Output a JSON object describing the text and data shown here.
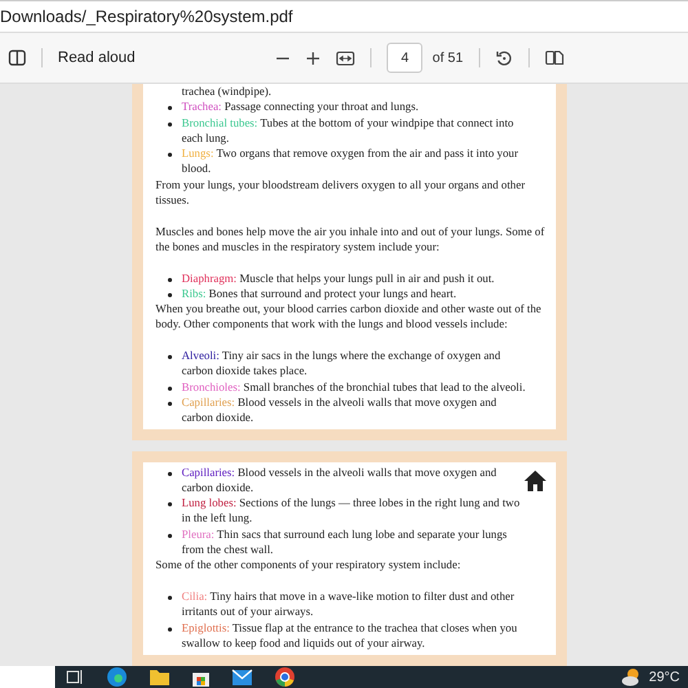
{
  "address_bar": {
    "url": "Downloads/_Respiratory%20system.pdf"
  },
  "toolbar": {
    "read_aloud": "Read aloud",
    "page_number": "4",
    "page_count": "of 51"
  },
  "pages": [
    {
      "blocks": [
        {
          "kind": "cont",
          "text": "trachea (windpipe)."
        },
        {
          "kind": "bullet",
          "term": "Trachea:",
          "color": "#d050c0",
          "text": " Passage connecting your throat and lungs."
        },
        {
          "kind": "bullet",
          "term": "Bronchial tubes:",
          "color": "#3cc890",
          "text": " Tubes at the bottom of your windpipe that connect into each lung."
        },
        {
          "kind": "bullet",
          "term": "Lungs:",
          "color": "#f0b040",
          "text": " Two organs that remove oxygen from the air and pass it into your blood."
        },
        {
          "kind": "para",
          "text": "From your lungs, your bloodstream delivers oxygen to all your organs and other tissues."
        },
        {
          "kind": "para",
          "text": "Muscles and bones help move the air you inhale into and out of your lungs. Some of the bones and muscles in the respiratory system include your:"
        },
        {
          "kind": "bullet",
          "term": "Diaphragm:",
          "color": "#e0305a",
          "text": " Muscle that helps your lungs pull in air and push it out."
        },
        {
          "kind": "bullet",
          "term": "Ribs:",
          "color": "#3cc890",
          "text": " Bones that surround and protect your lungs and heart."
        },
        {
          "kind": "para",
          "text": "When you breathe out, your blood carries carbon dioxide and other waste out of the body. Other components that work with the lungs and blood vessels include:"
        },
        {
          "kind": "bullet",
          "term": "Alveoli:",
          "color": "#3020a0",
          "text": " Tiny air sacs in the lungs where the exchange of oxygen and carbon dioxide takes place."
        },
        {
          "kind": "bullet",
          "term": "Bronchioles:",
          "color": "#e060c0",
          "text": " Small branches of the bronchial tubes that lead to the alveoli."
        },
        {
          "kind": "bullet",
          "term": "Capillaries:",
          "color": "#e0a050",
          "text": " Blood vessels in the alveoli walls that move oxygen and carbon dioxide."
        }
      ]
    },
    {
      "blocks": [
        {
          "kind": "bullet",
          "term": "Capillaries:",
          "color": "#6020c0",
          "text": " Blood vessels in the alveoli walls that move oxygen and carbon dioxide."
        },
        {
          "kind": "bullet",
          "term": "Lung lobes:",
          "color": "#c02040",
          "text": " Sections of the lungs — three lobes in the right lung and two in the left lung."
        },
        {
          "kind": "bullet",
          "term": "Pleura:",
          "color": "#e070c0",
          "text": " Thin sacs that surround each lung lobe and separate your lungs from the chest wall."
        },
        {
          "kind": "para",
          "text": "Some of the other components of your respiratory system include:"
        },
        {
          "kind": "bullet",
          "term": "Cilia:",
          "color": "#f08080",
          "text": " Tiny hairs that move in a wave-like motion to filter dust and other irritants out of your airways."
        },
        {
          "kind": "bullet",
          "term": "Epiglottis:",
          "color": "#e07050",
          "text": " Tissue flap at the entrance to the trachea that closes when you swallow to keep food and liquids out of your airway."
        }
      ]
    }
  ],
  "taskbar": {
    "temperature": "29°C"
  }
}
